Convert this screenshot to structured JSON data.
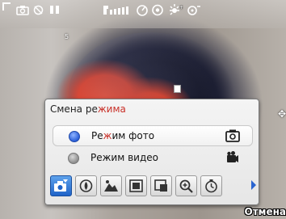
{
  "panel": {
    "title_prefix": "Смена ре",
    "title_highlight": "жима",
    "options": [
      {
        "label_before": "Ре",
        "label_highlight": "ж",
        "label_after": "им фото",
        "selected": true,
        "icon": "camera-icon"
      },
      {
        "label": "Режим видео",
        "selected": false,
        "icon": "video-camera-icon"
      }
    ],
    "toolbar_icons": [
      "camera-mode-icon",
      "white-balance-icon",
      "scene-icon",
      "frame-icon",
      "resolution-icon",
      "zoom-icon",
      "self-timer-icon"
    ]
  },
  "status_icons": [
    "capture-corner-icon",
    "camera-icon",
    "flash-off-icon",
    "battery-icon",
    "storage-icon",
    "timer-icon",
    "effect-icon",
    "brightness-icon",
    "tuning-icon"
  ],
  "softkey": {
    "cancel_label": "Отмена"
  },
  "colors": {
    "accent": "#c93028",
    "selection_blue": "#2a5fd8"
  }
}
